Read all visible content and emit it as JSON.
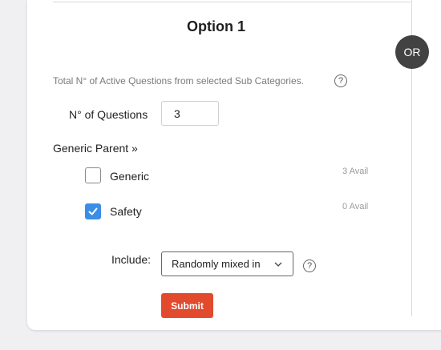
{
  "option_title": "Option 1",
  "or_badge": "OR",
  "total_active_text": "Total N° of Active Questions from selected Sub Categories.",
  "help_symbol": "?",
  "questions": {
    "label": "N° of Questions",
    "value": "3"
  },
  "generic_parent": {
    "label": "Generic Parent »"
  },
  "items": [
    {
      "label": "Generic",
      "checked": false,
      "avail": "3 Avail"
    },
    {
      "label": "Safety",
      "checked": true,
      "avail": "0 Avail"
    }
  ],
  "include": {
    "label": "Include:",
    "selected": "Randomly mixed in"
  },
  "submit_label": "Submit",
  "colors": {
    "accent": "#e24a2e",
    "checkbox": "#3b8ee8",
    "badge": "#424242"
  },
  "icons": {
    "help": "question-circle-icon",
    "chevron": "chevron-down-icon",
    "check": "check-icon"
  }
}
